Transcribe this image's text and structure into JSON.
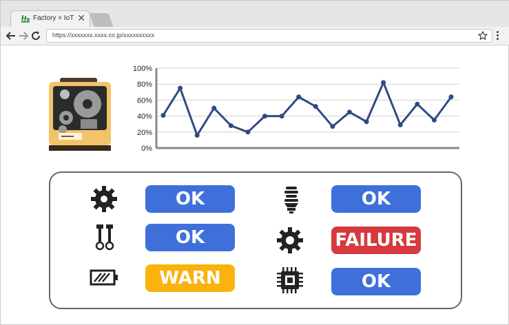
{
  "browser": {
    "tab_title": "Factory × IoT",
    "tab_close": "✕",
    "url": "https://xxxxxxx.xxxx.co.jp/xxxxxxxxxx",
    "back_icon": "arrow-left",
    "forward_icon": "arrow-right",
    "reload_icon": "reload",
    "star_icon": "star-outline",
    "menu_icon": "kebab"
  },
  "colors": {
    "ok": "#3f6fd9",
    "warn": "#fbb20c",
    "failure": "#d6393f",
    "line": "#2f4a83"
  },
  "status": [
    {
      "icon": "gear-icon",
      "label": "OK",
      "state": "ok"
    },
    {
      "icon": "bulb-icon",
      "label": "OK",
      "state": "ok"
    },
    {
      "icon": "bolts-icon",
      "label": "OK",
      "state": "ok"
    },
    {
      "icon": "gear-icon",
      "label": "FAILURE",
      "state": "failure"
    },
    {
      "icon": "battery-icon",
      "label": "WARN",
      "state": "warn"
    },
    {
      "icon": "chip-icon",
      "label": "OK",
      "state": "ok"
    }
  ],
  "chart_data": {
    "type": "line",
    "y_ticks": [
      "100%",
      "80%",
      "60%",
      "40%",
      "20%",
      "0%"
    ],
    "ylim": [
      0,
      100
    ],
    "grid": true,
    "series": [
      {
        "values": [
          41,
          75,
          16,
          50,
          28,
          20,
          40,
          40,
          64,
          52,
          27,
          45,
          33,
          82,
          29,
          55,
          35,
          64
        ]
      }
    ]
  }
}
